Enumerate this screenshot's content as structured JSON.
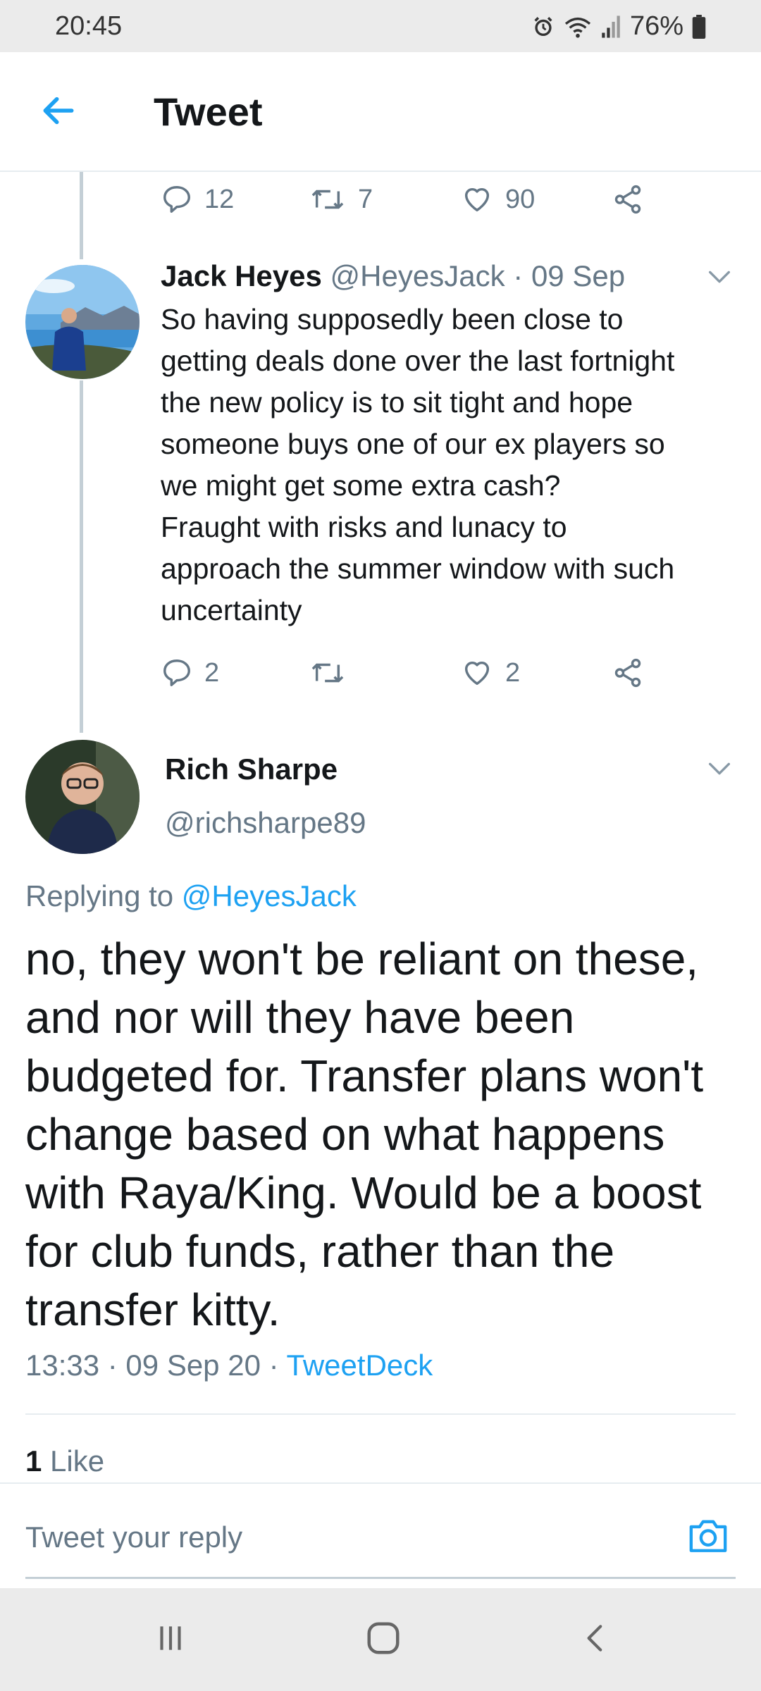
{
  "status_bar": {
    "time": "20:45",
    "battery_text": "76%",
    "icons": [
      "alarm-icon",
      "wifi-icon",
      "signal-icon",
      "battery-icon"
    ]
  },
  "header": {
    "title": "Tweet",
    "back_icon": "arrow-left-icon"
  },
  "previous_tweet_actions": {
    "replies": "12",
    "retweets": "7",
    "likes": "90"
  },
  "reply_tweet": {
    "name": "Jack Heyes",
    "handle": "@HeyesJack",
    "date": "09 Sep",
    "text": "So having supposedly been close to\ngetting deals done over the last fortnight\nthe new policy is to sit tight and hope\nsomeone buys one of our ex players so\nwe might get some extra cash?\nFraught with risks and lunacy to\napproach the summer window with such\nuncertainty",
    "replies": "2",
    "retweets": "",
    "likes": "2"
  },
  "main_tweet": {
    "name": "Rich Sharpe",
    "handle": "@richsharpe89",
    "replying_prefix": "Replying to",
    "replying_to": "@HeyesJack",
    "text": "no, they won't be reliant on these,\nand nor will they have been\nbudgeted for. Transfer plans won't\nchange based on what happens\nwith Raya/King. Would be a boost\nfor club funds, rather than the\ntransfer kitty.",
    "timestamp": "13:33 · 09 Sep 20 ·",
    "source": "TweetDeck",
    "like_count": "1",
    "like_label": "Like"
  },
  "reply_box": {
    "placeholder": "Tweet your reply"
  },
  "colors": {
    "accent": "#1da1f2",
    "text": "#14171a",
    "secondary": "#657786",
    "divider": "#e6ecf0",
    "system_bar": "#ebebeb"
  }
}
